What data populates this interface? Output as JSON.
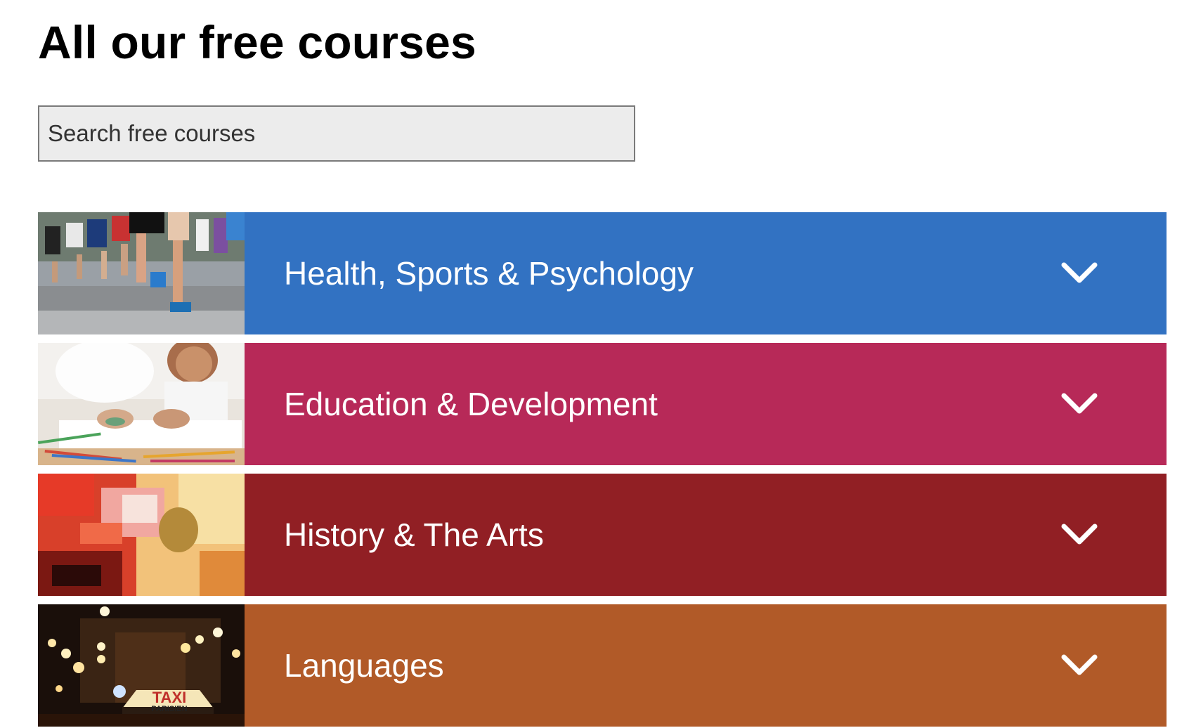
{
  "page": {
    "title": "All our free courses"
  },
  "search": {
    "placeholder": "Search free courses",
    "value": ""
  },
  "categories": [
    {
      "label": "Health, Sports & Psychology",
      "color": "#3272c2",
      "image": "marathon-runners-photo"
    },
    {
      "label": "Education & Development",
      "color": "#b72958",
      "image": "child-finger-painting-photo"
    },
    {
      "label": "History & The Arts",
      "color": "#911f24",
      "image": "abstract-painting-photo"
    },
    {
      "label": "Languages",
      "color": "#b15a28",
      "image": "paris-taxi-photo",
      "image_text": [
        "TAXI",
        "PARISIEN"
      ]
    }
  ],
  "icons": {
    "expand": "chevron-down-icon"
  }
}
